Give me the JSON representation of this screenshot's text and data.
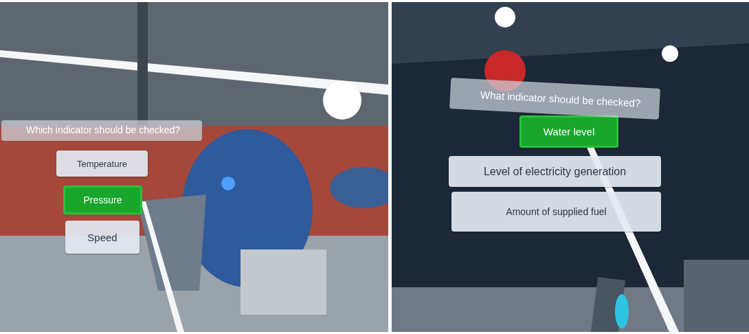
{
  "views": [
    {
      "question": "Which indicator should be checked?",
      "options": [
        {
          "label": "Temperature",
          "selected": false
        },
        {
          "label": "Pressure",
          "selected": true
        },
        {
          "label": "Speed",
          "selected": false
        }
      ]
    },
    {
      "question": "What indicator should be checked?",
      "options": [
        {
          "label": "Water level",
          "selected": true
        },
        {
          "label": "Level of electricity generation",
          "selected": false
        },
        {
          "label": "Amount of supplied fuel",
          "selected": false
        }
      ]
    }
  ]
}
